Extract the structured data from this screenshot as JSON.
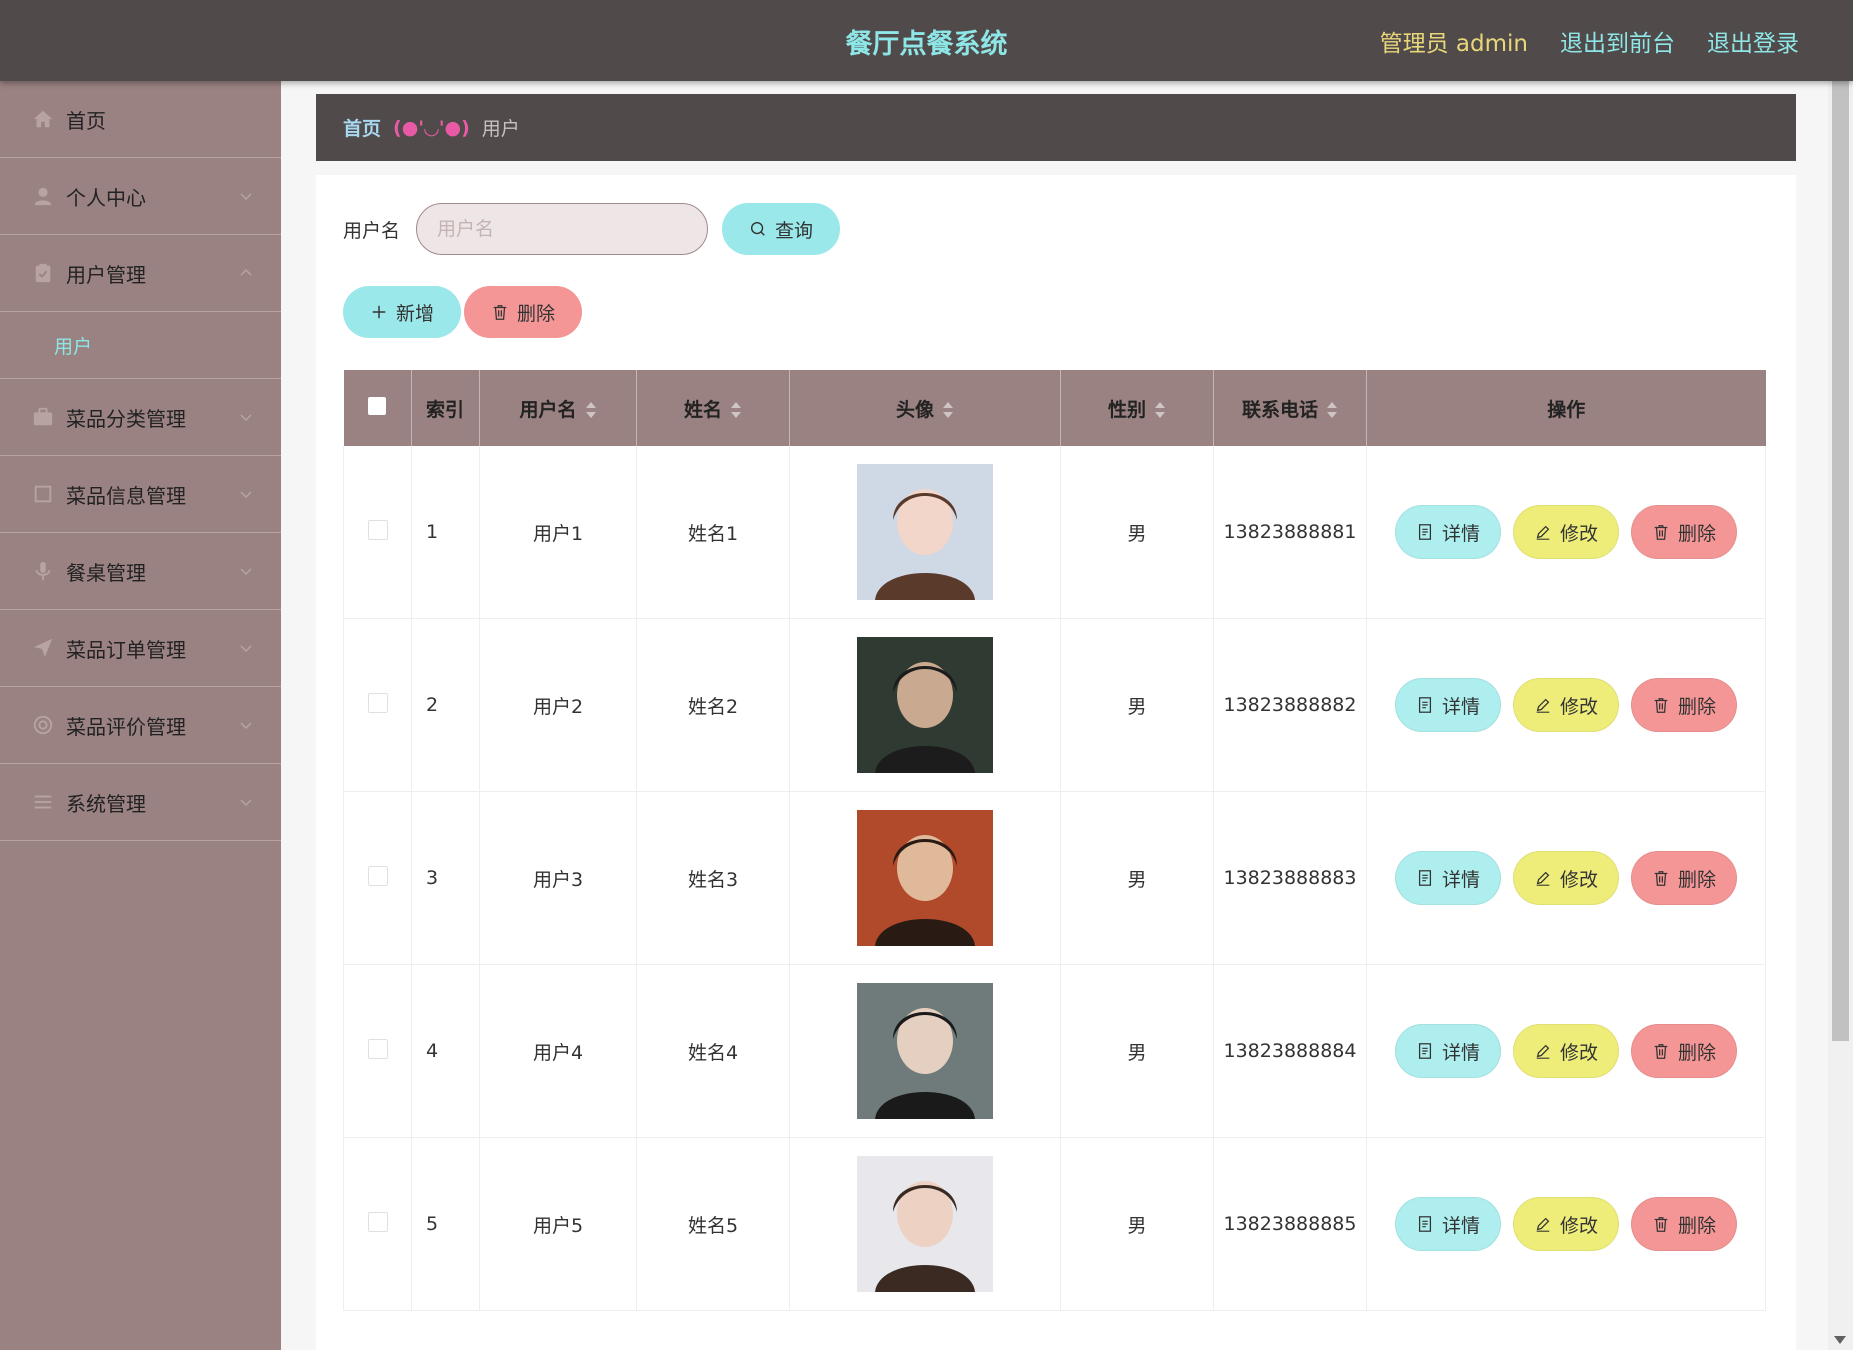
{
  "header": {
    "app_title": "餐厅点餐系统",
    "admin_label": "管理员 admin",
    "to_front_label": "退出到前台",
    "logout_label": "退出登录"
  },
  "sidebar": {
    "items": [
      {
        "label": "首页",
        "icon": "home-icon",
        "expanded": false
      },
      {
        "label": "个人中心",
        "icon": "user-icon",
        "expanded": false
      },
      {
        "label": "用户管理",
        "icon": "clipboard-icon",
        "expanded": true,
        "children": [
          "用户"
        ]
      },
      {
        "label": "菜品分类管理",
        "icon": "briefcase-icon",
        "expanded": false
      },
      {
        "label": "菜品信息管理",
        "icon": "square-icon",
        "expanded": false
      },
      {
        "label": "餐桌管理",
        "icon": "microphone-icon",
        "expanded": false
      },
      {
        "label": "菜品订单管理",
        "icon": "send-icon",
        "expanded": false
      },
      {
        "label": "菜品评价管理",
        "icon": "circle-icon",
        "expanded": false
      },
      {
        "label": "系统管理",
        "icon": "menu-icon",
        "expanded": false
      }
    ]
  },
  "breadcrumb": {
    "home": "首页",
    "separator": "(●'◡'●)",
    "current": "用户"
  },
  "search": {
    "label": "用户名",
    "placeholder": "用户名",
    "value": "",
    "query_button": "查询"
  },
  "actions": {
    "add_button": "新增",
    "delete_button": "删除"
  },
  "table": {
    "columns": [
      "",
      "索引",
      "用户名",
      "姓名",
      "头像",
      "性别",
      "联系电话",
      "操作"
    ],
    "sortable": [
      false,
      false,
      true,
      true,
      true,
      true,
      true,
      false
    ],
    "row_buttons": {
      "detail": "详情",
      "edit": "修改",
      "delete": "删除"
    },
    "rows": [
      {
        "index": "1",
        "username": "用户1",
        "name": "姓名1",
        "avatar": "avatar-photo",
        "gender": "男",
        "phone": "13823888881"
      },
      {
        "index": "2",
        "username": "用户2",
        "name": "姓名2",
        "avatar": "avatar-photo",
        "gender": "男",
        "phone": "13823888882"
      },
      {
        "index": "3",
        "username": "用户3",
        "name": "姓名3",
        "avatar": "avatar-photo",
        "gender": "男",
        "phone": "13823888883"
      },
      {
        "index": "4",
        "username": "用户4",
        "name": "姓名4",
        "avatar": "avatar-photo",
        "gender": "男",
        "phone": "13823888884"
      },
      {
        "index": "5",
        "username": "用户5",
        "name": "姓名5",
        "avatar": "avatar-photo",
        "gender": "男",
        "phone": "13823888885"
      }
    ]
  },
  "colors": {
    "topbar_bg": "#504a4a",
    "sidebar_bg": "#9a8282",
    "accent_cyan": "#8ee6e6",
    "accent_yellow": "#e8d77a",
    "button_cyan": "#9be8ea",
    "button_red": "#f49696",
    "button_yellow": "#eeed7a"
  }
}
